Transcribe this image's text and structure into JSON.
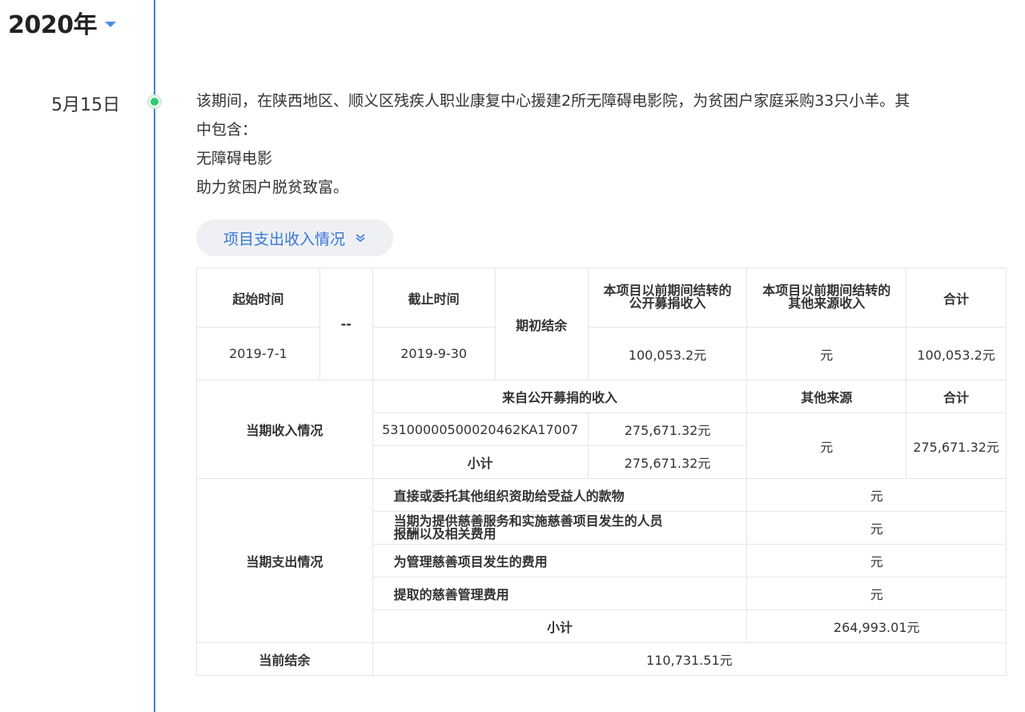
{
  "year": {
    "label": "2020年"
  },
  "entry": {
    "date": "5月15日",
    "lines": [
      "该期间，在陕西地区、顺义区残疾人职业康复中心援建2所无障碍电影院，为贫困户家庭采购33只小羊。其",
      "中包含：",
      "无障碍电影",
      "助力贫困户脱贫致富。"
    ],
    "toggle_label": "项目支出收入情况"
  },
  "table": {
    "header": {
      "start_label": "起始时间",
      "dash": "--",
      "end_label": "截止时间",
      "opening_label": "期初结余",
      "public_prev_line1": "本项目以前期间结转的",
      "public_prev_line2": "公开募捐收入",
      "other_prev_line1": "本项目以前期间结转的",
      "other_prev_line2": "其他来源收入",
      "total_label": "合计"
    },
    "period": {
      "start": "2019-7-1",
      "end": "2019-9-30",
      "public_prev": "100,053.2元",
      "other_prev": "元",
      "total": "100,053.2元"
    },
    "income": {
      "label": "当期收入情况",
      "public_header": "来自公开募捐的收入",
      "other_header": "其他来源",
      "total_header": "合计",
      "record_no": "53100000500020462KA17007",
      "record_amount": "275,671.32元",
      "subtotal_label": "小计",
      "subtotal_amount": "275,671.32元",
      "other_value": "元",
      "total_value": "275,671.32元"
    },
    "expense": {
      "label": "当期支出情况",
      "items": [
        {
          "label": "直接或委托其他组织资助给受益人的款物",
          "value": "元"
        },
        {
          "label_line1": "当期为提供慈善服务和实施慈善项目发生的人员",
          "label_line2": "报酬以及相关费用",
          "value": "元"
        },
        {
          "label": "为管理慈善项目发生的费用",
          "value": "元"
        },
        {
          "label": "提取的慈善管理费用",
          "value": "元"
        }
      ],
      "subtotal_label": "小计",
      "subtotal_value": "264,993.01元"
    },
    "balance": {
      "label": "当前结余",
      "value": "110,731.51元"
    }
  },
  "colors": {
    "accent": "#3a78d6",
    "timeline": "#4a7fd4",
    "dot": "#2ecc71"
  }
}
